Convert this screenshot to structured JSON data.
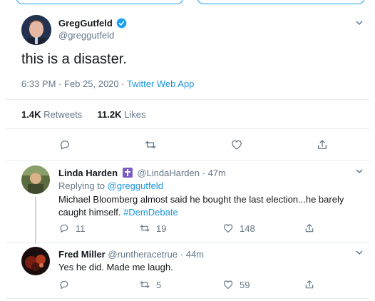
{
  "main_tweet": {
    "author_name": "GregGutfeld",
    "author_handle": "@greggutfeld",
    "text": "this is a disaster.",
    "time": "6:33 PM",
    "separator": "·",
    "date": "Feb 25, 2020",
    "source": "Twitter Web App",
    "retweets_count": "1.4K",
    "retweets_label": "Retweets",
    "likes_count": "11.2K",
    "likes_label": "Likes"
  },
  "replies": [
    {
      "author_name": "Linda Harden",
      "author_handle": "@LindaHarden",
      "separator": "·",
      "time": "47m",
      "replying_prefix": "Replying to",
      "replying_to": "@greggutfeld",
      "text_line1": "Michael Bloomberg almost said he bought the last election...he barely",
      "text_line2": "caught himself.",
      "hashtag": "#DemDebate",
      "reply_count": "11",
      "retweet_count": "19",
      "like_count": "148"
    },
    {
      "author_name": "Fred Miller",
      "author_handle": "@runtheracetrue",
      "separator": "·",
      "time": "44m",
      "text": "Yes he did. Made me laugh.",
      "reply_count": "",
      "retweet_count": "5",
      "like_count": "59"
    }
  ],
  "colors": {
    "accent": "#1da1f2",
    "link": "#1b95e0",
    "muted": "#657786",
    "divider": "#e6ecf0"
  }
}
